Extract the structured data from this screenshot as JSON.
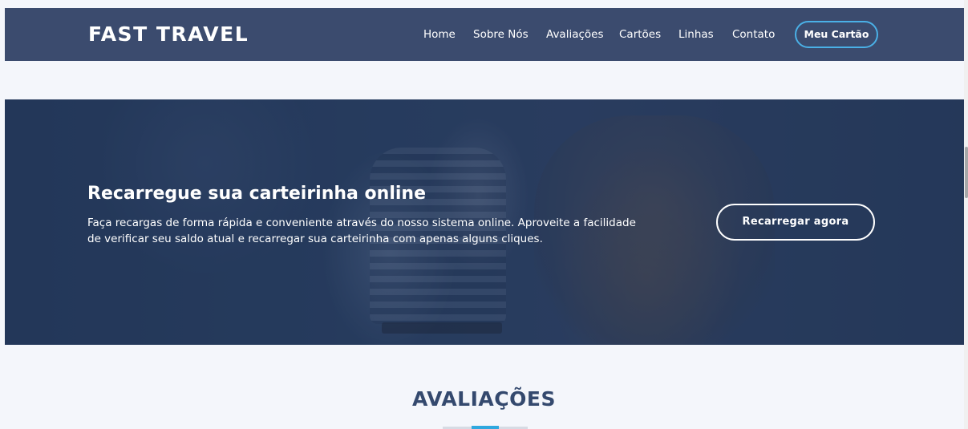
{
  "header": {
    "brand": "FAST TRAVEL",
    "nav": [
      {
        "label": "Home"
      },
      {
        "label": "Sobre Nós"
      },
      {
        "label": "Avaliações"
      },
      {
        "label": "Cartões"
      },
      {
        "label": "Linhas"
      },
      {
        "label": "Contato"
      }
    ],
    "cta_label": "Meu Cartão"
  },
  "hero": {
    "title": "Recarregue sua carteirinha online",
    "text": "Faça recargas de forma rápida e conveniente através do nosso sistema online. Aproveite a facilidade de verificar seu saldo atual e recarregar sua carteirinha com apenas alguns cliques.",
    "button_label": "Recarregar agora"
  },
  "reviews": {
    "title": "AVALIAÇÕES"
  },
  "colors": {
    "header_bg": "#3b4b6e",
    "accent": "#2fa8df",
    "title_color": "#34496e",
    "page_bg": "#f4f6fb"
  }
}
